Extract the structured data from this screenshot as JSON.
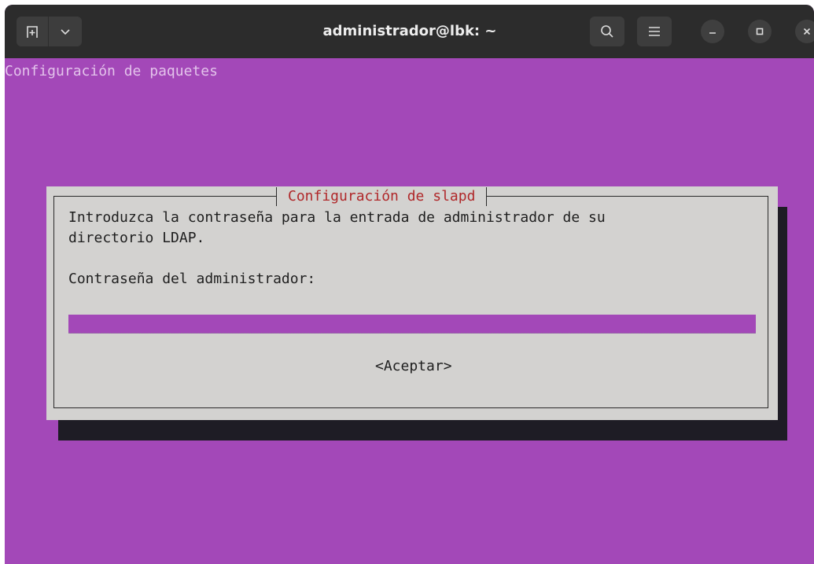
{
  "window": {
    "title": "administrador@lbk: ~"
  },
  "terminal": {
    "heading": "Configuración de paquetes"
  },
  "dialog": {
    "title": "Configuración de slapd",
    "prompt_line1": "Introduzca la contraseña para la entrada de administrador de su",
    "prompt_line2": "directorio LDAP.",
    "password_label": "Contraseña del administrador:",
    "password_value": "",
    "accept_label": "<Aceptar>"
  },
  "colors": {
    "terminal_background": "#A348B8",
    "dialog_background": "#D3D2D0",
    "dialog_title": "#B0282A",
    "titlebar": "#2C2C2C"
  },
  "icons": {
    "new_tab": "new-tab-icon",
    "tab_menu": "chevron-down-icon",
    "search": "search-icon",
    "menu": "hamburger-icon",
    "minimize": "minimize-icon",
    "maximize": "maximize-icon",
    "close": "close-icon"
  }
}
